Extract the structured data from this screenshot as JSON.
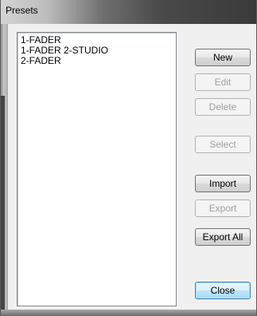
{
  "window": {
    "title": "Presets"
  },
  "presets_list": {
    "items": [
      "1-FADER",
      "1-FADER 2-STUDIO",
      "2-FADER"
    ]
  },
  "buttons": {
    "new": "New",
    "edit": "Edit",
    "delete": "Delete",
    "select": "Select",
    "import": "Import",
    "export": "Export",
    "export_all": "Export All",
    "close": "Close"
  }
}
